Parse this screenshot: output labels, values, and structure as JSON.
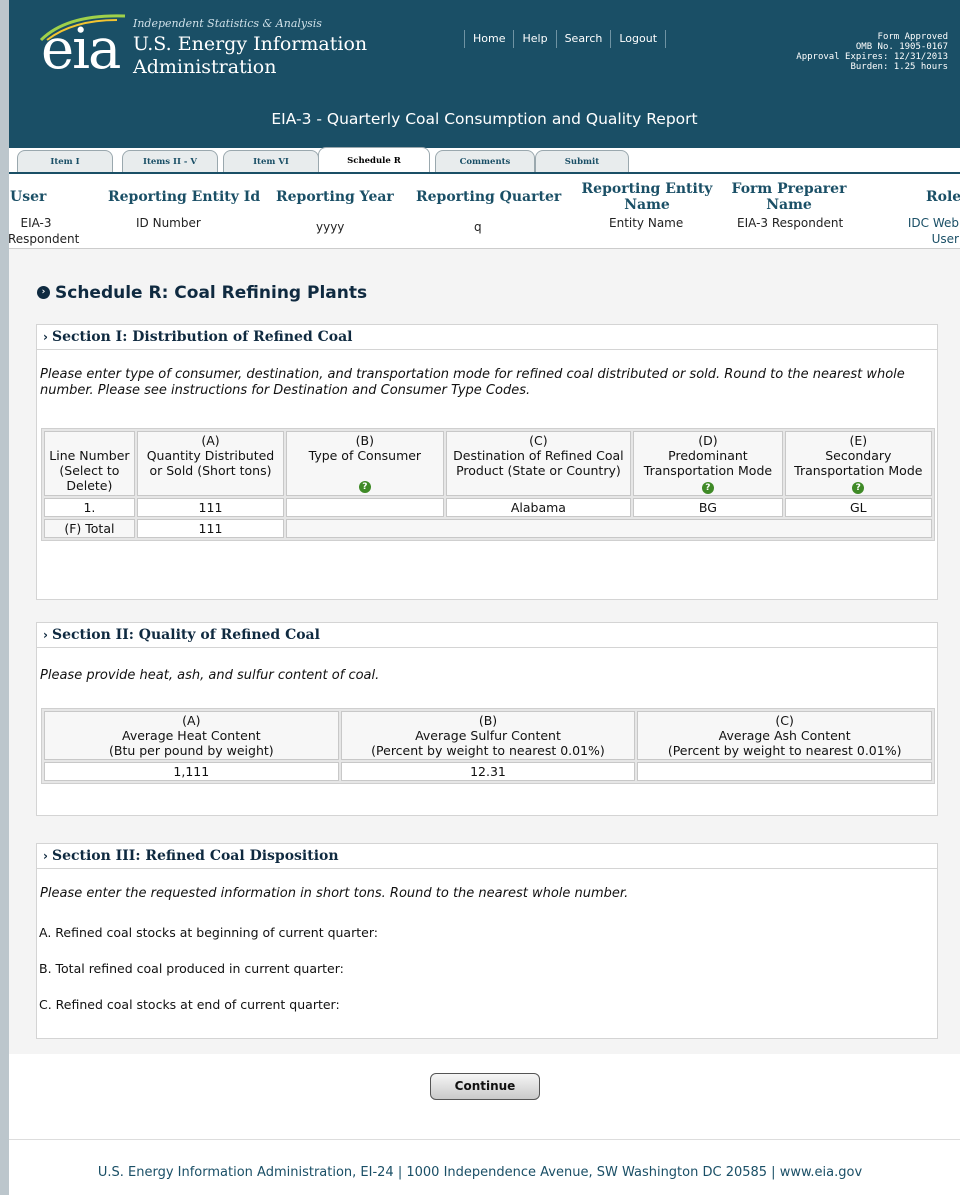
{
  "header": {
    "tagline": "Independent Statistics & Analysis",
    "logo_mark": "eia",
    "org_line1": "U.S. Energy Information",
    "org_line2": "Administration",
    "nav": [
      "Home",
      "Help",
      "Search",
      "Logout"
    ],
    "form_approved": [
      "Form Approved",
      "OMB No. 1905-0167",
      "Approval Expires: 12/31/2013",
      "Burden: 1.25 hours"
    ],
    "report_title": "EIA-3 - Quarterly Coal Consumption and Quality Report"
  },
  "tabs": [
    "Item I",
    "Items II - V",
    "Item VI",
    "Schedule R",
    "Comments",
    "Submit"
  ],
  "active_tab": "Schedule R",
  "info": {
    "headers": [
      "User",
      "Reporting Entity Id",
      "Reporting Year",
      "Reporting Quarter",
      "Reporting Entity Name",
      "Form Preparer Name",
      "Role"
    ],
    "values": [
      "EIA-3 Respondent",
      "ID Number",
      "yyyy",
      "q",
      "Entity Name",
      "EIA-3 Respondent",
      "IDC Web User"
    ]
  },
  "page_title": "Schedule R: Coal Refining Plants",
  "section1": {
    "title": "Section I: Distribution of Refined Coal",
    "instructions": "Please enter type of consumer, destination, and transportation mode for refined coal distributed or sold. Round to the nearest whole number. Please see instructions for Destination and Consumer Type Codes.",
    "columns": [
      {
        "letter": "",
        "label": "Line Number (Select to Delete)"
      },
      {
        "letter": "(A)",
        "label": "Quantity Distributed or Sold (Short tons)"
      },
      {
        "letter": "(B)",
        "label": "Type of Consumer"
      },
      {
        "letter": "(C)",
        "label": "Destination of Refined Coal Product (State or Country)"
      },
      {
        "letter": "(D)",
        "label": "Predominant Transportation Mode"
      },
      {
        "letter": "(E)",
        "label": "Secondary Transportation Mode"
      }
    ],
    "rows": [
      [
        "1.",
        "111",
        "",
        "Alabama",
        "BG",
        "GL"
      ]
    ],
    "total_label": "(F) Total",
    "total_value": "111"
  },
  "section2": {
    "title": "Section II: Quality of Refined Coal",
    "instructions": "Please provide heat, ash, and sulfur content of coal.",
    "columns": [
      {
        "letter": "(A)",
        "label": "Average Heat Content",
        "unit": "(Btu per pound by weight)"
      },
      {
        "letter": "(B)",
        "label": "Average Sulfur Content",
        "unit": "(Percent by weight to nearest 0.01%)"
      },
      {
        "letter": "(C)",
        "label": "Average Ash Content",
        "unit": "(Percent by weight to nearest 0.01%)"
      }
    ],
    "values": [
      "1,111",
      "12.31",
      ""
    ]
  },
  "section3": {
    "title": "Section III: Refined Coal Disposition",
    "instructions": "Please enter the requested information in short tons. Round to the nearest whole number.",
    "items": [
      "A.  Refined coal stocks at beginning of current quarter:",
      "B.  Total refined coal produced in current quarter:",
      "C.  Refined coal stocks at end of current quarter:"
    ]
  },
  "continue_label": "Continue",
  "footer": "U.S. Energy Information Administration, EI-24 | 1000 Independence Avenue, SW Washington DC 20585  | www.eia.gov",
  "colors": {
    "header_bg": "#1a4f66",
    "help_icon": "#3f8a27",
    "heading": "#0f2a40"
  }
}
